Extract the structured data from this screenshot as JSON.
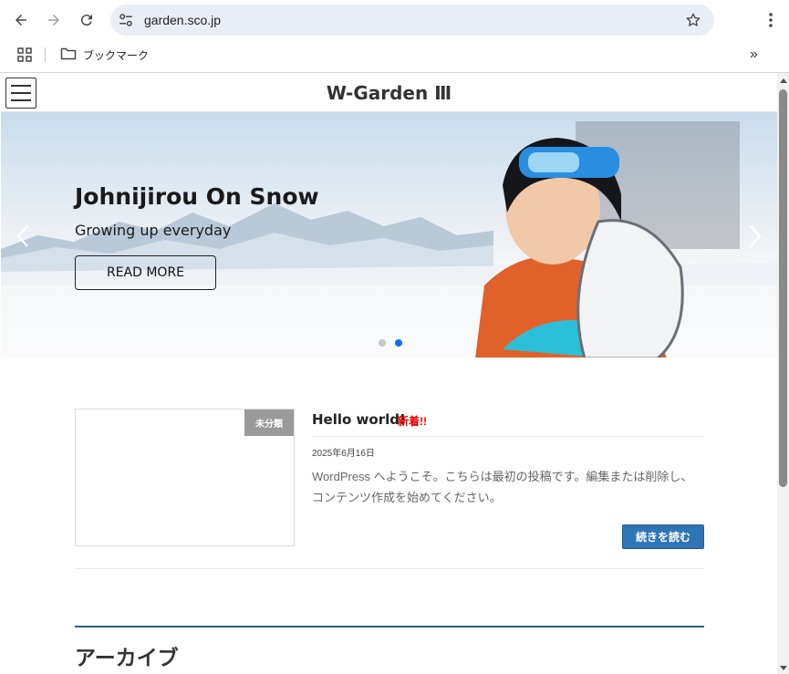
{
  "browser": {
    "url": "garden.sco.jp",
    "bookmark_folder": "ブックマーク",
    "overflow": "»"
  },
  "site": {
    "title": "W-Garden Ⅲ"
  },
  "hero": {
    "title": "Johnijirou On Snow",
    "subtitle": "Growing up everyday",
    "button_label": "READ MORE",
    "slide_count": 2,
    "active_slide": 2
  },
  "post": {
    "category": "未分類",
    "title": "Hello world!",
    "new_badge": "新着!!",
    "date": "2025年6月16日",
    "excerpt": "WordPress へようこそ。こちらは最初の投稿です。編集または削除し、コンテンツ作成を始めてください。",
    "read_more_label": "続きを読む"
  },
  "archive": {
    "title": "アーカイブ"
  },
  "colors": {
    "accent_blue": "#2f74b5",
    "new_red": "#e60000",
    "active_dot": "#0d6efd",
    "archive_rule": "#2a5d87"
  }
}
